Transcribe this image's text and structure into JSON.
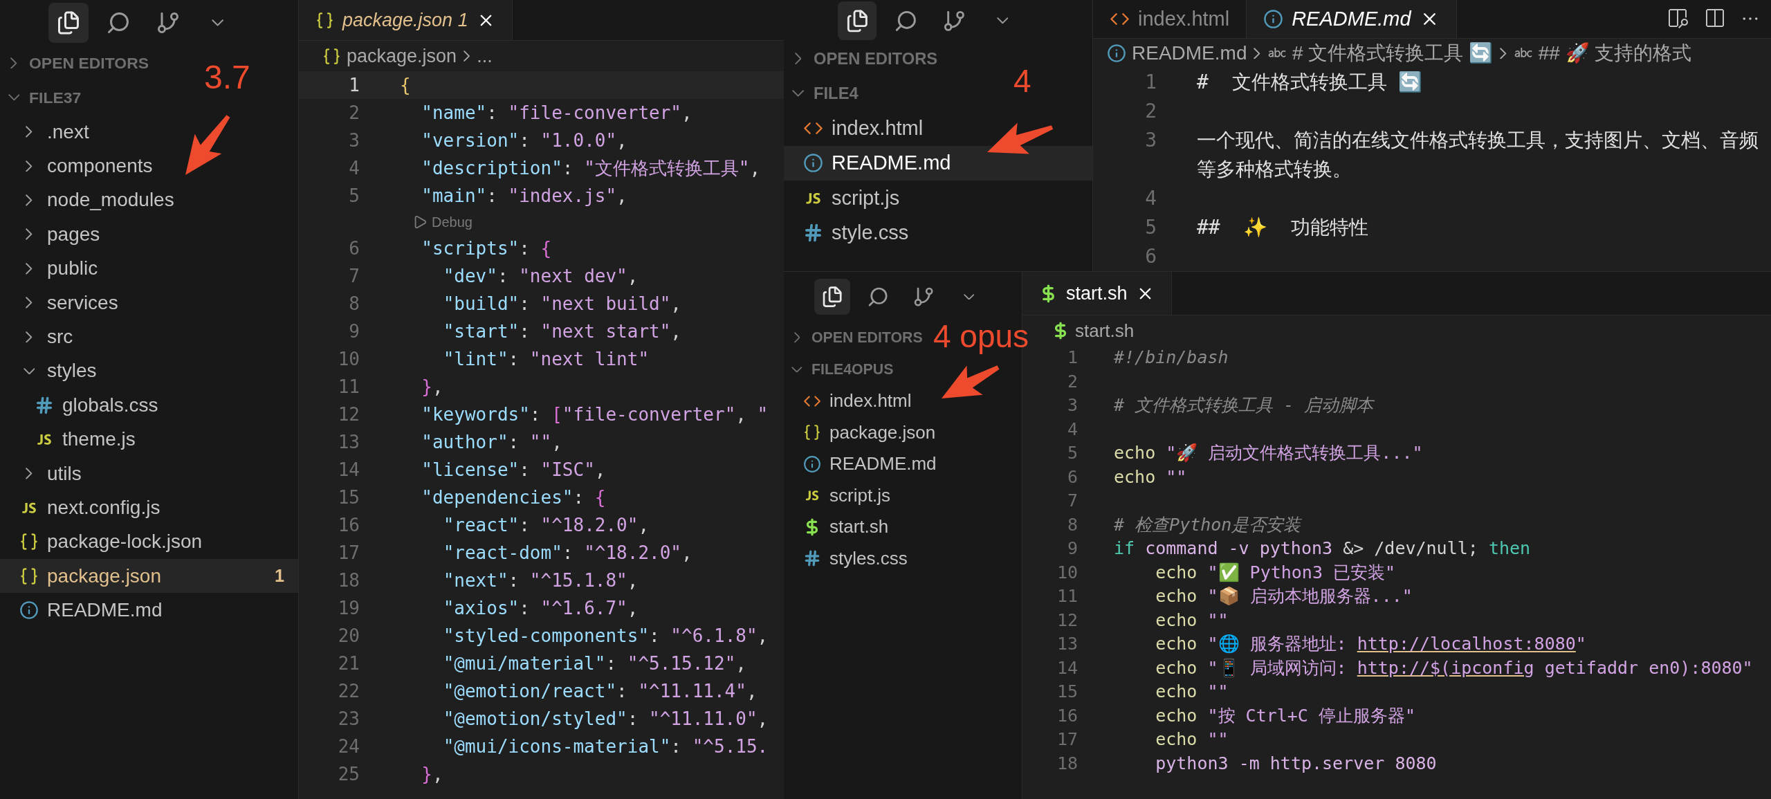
{
  "explorer_file37": {
    "annotation": "3.7",
    "sections": [
      {
        "label": "OPEN EDITORS",
        "expanded": false
      },
      {
        "label": "FILE37",
        "expanded": true
      }
    ],
    "items": [
      {
        "name": ".next",
        "kind": "folder",
        "expanded": false,
        "selected": false
      },
      {
        "name": "components",
        "kind": "folder",
        "expanded": false,
        "selected": false
      },
      {
        "name": "node_modules",
        "kind": "folder",
        "expanded": false,
        "selected": false
      },
      {
        "name": "pages",
        "kind": "folder",
        "expanded": false,
        "selected": false
      },
      {
        "name": "public",
        "kind": "folder",
        "expanded": false,
        "selected": false
      },
      {
        "name": "services",
        "kind": "folder",
        "expanded": false,
        "selected": false
      },
      {
        "name": "src",
        "kind": "folder",
        "expanded": false,
        "selected": false
      },
      {
        "name": "styles",
        "kind": "folder",
        "expanded": true,
        "selected": false,
        "children": [
          {
            "name": "globals.css",
            "kind": "css",
            "selected": false
          },
          {
            "name": "theme.js",
            "kind": "js",
            "selected": false
          }
        ]
      },
      {
        "name": "utils",
        "kind": "folder",
        "expanded": false,
        "selected": false
      },
      {
        "name": "next.config.js",
        "kind": "js",
        "selected": false
      },
      {
        "name": "package-lock.json",
        "kind": "json",
        "selected": false
      },
      {
        "name": "package.json",
        "kind": "json",
        "selected": true,
        "problems": "1"
      },
      {
        "name": "README.md",
        "kind": "md",
        "selected": false
      }
    ]
  },
  "editor_package_json": {
    "tabs": [
      {
        "label": "package.json",
        "kind": "json",
        "preview": true,
        "problems": "1",
        "selected": true
      }
    ],
    "breadcrumb": [
      {
        "text": "package.json",
        "kind": "json"
      },
      {
        "text": "...",
        "kind": "none"
      }
    ],
    "lines": [
      {
        "kind": "code",
        "number": "1",
        "current": true,
        "tokens": [
          {
            "kind": "brace",
            "text": "{"
          }
        ]
      },
      {
        "kind": "code",
        "number": "2",
        "current": false,
        "tokens": [
          {
            "kind": "key",
            "text": "  \"name\""
          },
          {
            "kind": "pun",
            "text": ": "
          },
          {
            "kind": "str",
            "text": "\"file-converter\""
          },
          {
            "kind": "pun",
            "text": ","
          }
        ]
      },
      {
        "kind": "code",
        "number": "3",
        "current": false,
        "tokens": [
          {
            "kind": "key",
            "text": "  \"version\""
          },
          {
            "kind": "pun",
            "text": ": "
          },
          {
            "kind": "str",
            "text": "\"1.0.0\""
          },
          {
            "kind": "pun",
            "text": ","
          }
        ]
      },
      {
        "kind": "code",
        "number": "4",
        "current": false,
        "tokens": [
          {
            "kind": "key",
            "text": "  \"description\""
          },
          {
            "kind": "pun",
            "text": ": "
          },
          {
            "kind": "str",
            "text": "\"文件格式转换工具\""
          },
          {
            "kind": "pun",
            "text": ","
          }
        ]
      },
      {
        "kind": "code",
        "number": "5",
        "current": false,
        "tokens": [
          {
            "kind": "key",
            "text": "  \"main\""
          },
          {
            "kind": "pun",
            "text": ": "
          },
          {
            "kind": "str",
            "text": "\"index.js\""
          },
          {
            "kind": "pun",
            "text": ","
          }
        ]
      },
      {
        "kind": "lens",
        "text": "Debug"
      },
      {
        "kind": "code",
        "number": "6",
        "current": false,
        "tokens": [
          {
            "kind": "key",
            "text": "  \"scripts\""
          },
          {
            "kind": "pun",
            "text": ": "
          },
          {
            "kind": "brace2",
            "text": "{"
          }
        ]
      },
      {
        "kind": "code",
        "number": "7",
        "current": false,
        "tokens": [
          {
            "kind": "key",
            "text": "    \"dev\""
          },
          {
            "kind": "pun",
            "text": ": "
          },
          {
            "kind": "str",
            "text": "\"next dev\""
          },
          {
            "kind": "pun",
            "text": ","
          }
        ]
      },
      {
        "kind": "code",
        "number": "8",
        "current": false,
        "tokens": [
          {
            "kind": "key",
            "text": "    \"build\""
          },
          {
            "kind": "pun",
            "text": ": "
          },
          {
            "kind": "str",
            "text": "\"next build\""
          },
          {
            "kind": "pun",
            "text": ","
          }
        ]
      },
      {
        "kind": "code",
        "number": "9",
        "current": false,
        "tokens": [
          {
            "kind": "key",
            "text": "    \"start\""
          },
          {
            "kind": "pun",
            "text": ": "
          },
          {
            "kind": "str",
            "text": "\"next start\""
          },
          {
            "kind": "pun",
            "text": ","
          }
        ]
      },
      {
        "kind": "code",
        "number": "10",
        "current": false,
        "tokens": [
          {
            "kind": "key",
            "text": "    \"lint\""
          },
          {
            "kind": "pun",
            "text": ": "
          },
          {
            "kind": "str",
            "text": "\"next lint\""
          }
        ]
      },
      {
        "kind": "code",
        "number": "11",
        "current": false,
        "tokens": [
          {
            "kind": "brace2",
            "text": "  }"
          },
          {
            "kind": "pun",
            "text": ","
          }
        ]
      },
      {
        "kind": "code",
        "number": "12",
        "current": false,
        "tokens": [
          {
            "kind": "key",
            "text": "  \"keywords\""
          },
          {
            "kind": "pun",
            "text": ": "
          },
          {
            "kind": "brace2",
            "text": "["
          },
          {
            "kind": "str",
            "text": "\"file-converter\""
          },
          {
            "kind": "pun",
            "text": ", "
          },
          {
            "kind": "str",
            "text": "\""
          }
        ]
      },
      {
        "kind": "code",
        "number": "13",
        "current": false,
        "tokens": [
          {
            "kind": "key",
            "text": "  \"author\""
          },
          {
            "kind": "pun",
            "text": ": "
          },
          {
            "kind": "str",
            "text": "\"\""
          },
          {
            "kind": "pun",
            "text": ","
          }
        ]
      },
      {
        "kind": "code",
        "number": "14",
        "current": false,
        "tokens": [
          {
            "kind": "key",
            "text": "  \"license\""
          },
          {
            "kind": "pun",
            "text": ": "
          },
          {
            "kind": "str",
            "text": "\"ISC\""
          },
          {
            "kind": "pun",
            "text": ","
          }
        ]
      },
      {
        "kind": "code",
        "number": "15",
        "current": false,
        "tokens": [
          {
            "kind": "key",
            "text": "  \"dependencies\""
          },
          {
            "kind": "pun",
            "text": ": "
          },
          {
            "kind": "brace2",
            "text": "{"
          }
        ]
      },
      {
        "kind": "code",
        "number": "16",
        "current": false,
        "tokens": [
          {
            "kind": "key",
            "text": "    \"react\""
          },
          {
            "kind": "pun",
            "text": ": "
          },
          {
            "kind": "str",
            "text": "\"^18.2.0\""
          },
          {
            "kind": "pun",
            "text": ","
          }
        ]
      },
      {
        "kind": "code",
        "number": "17",
        "current": false,
        "tokens": [
          {
            "kind": "key",
            "text": "    \"react-dom\""
          },
          {
            "kind": "pun",
            "text": ": "
          },
          {
            "kind": "str",
            "text": "\"^18.2.0\""
          },
          {
            "kind": "pun",
            "text": ","
          }
        ]
      },
      {
        "kind": "code",
        "number": "18",
        "current": false,
        "tokens": [
          {
            "kind": "key",
            "text": "    \"next\""
          },
          {
            "kind": "pun",
            "text": ": "
          },
          {
            "kind": "str",
            "text": "\"^15.1.8\""
          },
          {
            "kind": "pun",
            "text": ","
          }
        ]
      },
      {
        "kind": "code",
        "number": "19",
        "current": false,
        "tokens": [
          {
            "kind": "key",
            "text": "    \"axios\""
          },
          {
            "kind": "pun",
            "text": ": "
          },
          {
            "kind": "str",
            "text": "\"^1.6.7\""
          },
          {
            "kind": "pun",
            "text": ","
          }
        ]
      },
      {
        "kind": "code",
        "number": "20",
        "current": false,
        "tokens": [
          {
            "kind": "key",
            "text": "    \"styled-components\""
          },
          {
            "kind": "pun",
            "text": ": "
          },
          {
            "kind": "str",
            "text": "\"^6.1.8\""
          },
          {
            "kind": "pun",
            "text": ","
          }
        ]
      },
      {
        "kind": "code",
        "number": "21",
        "current": false,
        "tokens": [
          {
            "kind": "key",
            "text": "    \"@mui/material\""
          },
          {
            "kind": "pun",
            "text": ": "
          },
          {
            "kind": "str",
            "text": "\"^5.15.12\""
          },
          {
            "kind": "pun",
            "text": ","
          }
        ]
      },
      {
        "kind": "code",
        "number": "22",
        "current": false,
        "tokens": [
          {
            "kind": "key",
            "text": "    \"@emotion/react\""
          },
          {
            "kind": "pun",
            "text": ": "
          },
          {
            "kind": "str",
            "text": "\"^11.11.4\""
          },
          {
            "kind": "pun",
            "text": ","
          }
        ]
      },
      {
        "kind": "code",
        "number": "23",
        "current": false,
        "tokens": [
          {
            "kind": "key",
            "text": "    \"@emotion/styled\""
          },
          {
            "kind": "pun",
            "text": ": "
          },
          {
            "kind": "str",
            "text": "\"^11.11.0\""
          },
          {
            "kind": "pun",
            "text": ","
          }
        ]
      },
      {
        "kind": "code",
        "number": "24",
        "current": false,
        "tokens": [
          {
            "kind": "key",
            "text": "    \"@mui/icons-material\""
          },
          {
            "kind": "pun",
            "text": ": "
          },
          {
            "kind": "str",
            "text": "\"^5.15."
          }
        ]
      },
      {
        "kind": "code",
        "number": "25",
        "current": false,
        "tokens": [
          {
            "kind": "brace2",
            "text": "  }"
          },
          {
            "kind": "pun",
            "text": ","
          }
        ]
      }
    ]
  },
  "explorer_file4": {
    "annotation": "4",
    "sections": [
      {
        "label": "OPEN EDITORS",
        "expanded": false
      },
      {
        "label": "FILE4",
        "expanded": true
      }
    ],
    "items": [
      {
        "name": "index.html",
        "kind": "html",
        "selected": false
      },
      {
        "name": "README.md",
        "kind": "md",
        "selected": true
      },
      {
        "name": "script.js",
        "kind": "js",
        "selected": false
      },
      {
        "name": "style.css",
        "kind": "css",
        "selected": false
      }
    ]
  },
  "editor_readme": {
    "tabs": [
      {
        "label": "index.html",
        "kind": "html",
        "preview": false,
        "selected": false
      },
      {
        "label": "README.md",
        "kind": "md",
        "preview": true,
        "selected": true
      }
    ],
    "breadcrumb": [
      {
        "text": "README.md",
        "kind": "md"
      },
      {
        "text": "# 文件格式转换工具 🔄",
        "kind": "heading"
      },
      {
        "text": "## 🚀 支持的格式",
        "kind": "heading"
      }
    ],
    "lines": [
      {
        "kind": "code",
        "number": "1",
        "tokens": [
          {
            "kind": "txt",
            "text": "#  文件格式转换工具 🔄"
          }
        ]
      },
      {
        "kind": "code",
        "number": "2"
      },
      {
        "kind": "code",
        "number": "3",
        "tokens": [
          {
            "kind": "txt",
            "text": "一个现代、简洁的在线文件格式转换工具，支持图片、文档、音频等多种格式转换。"
          }
        ]
      },
      {
        "kind": "code",
        "number": "4"
      },
      {
        "kind": "code",
        "number": "5",
        "tokens": [
          {
            "kind": "txt",
            "text": "##  ✨  功能特性"
          }
        ]
      },
      {
        "kind": "code",
        "number": "6"
      }
    ]
  },
  "explorer_file4opus": {
    "annotation": "4 opus",
    "sections": [
      {
        "label": "OPEN EDITORS",
        "expanded": false
      },
      {
        "label": "FILE4OPUS",
        "expanded": true
      }
    ],
    "items": [
      {
        "name": "index.html",
        "kind": "html",
        "selected": false
      },
      {
        "name": "package.json",
        "kind": "json",
        "selected": false
      },
      {
        "name": "README.md",
        "kind": "md",
        "selected": false
      },
      {
        "name": "script.js",
        "kind": "js",
        "selected": false
      },
      {
        "name": "start.sh",
        "kind": "sh",
        "selected": false
      },
      {
        "name": "styles.css",
        "kind": "css",
        "selected": false
      }
    ]
  },
  "editor_start_sh": {
    "tabs": [
      {
        "label": "start.sh",
        "kind": "sh",
        "preview": false,
        "selected": true
      }
    ],
    "breadcrumb": [
      {
        "text": "start.sh",
        "kind": "sh"
      }
    ],
    "lines": [
      {
        "kind": "code",
        "number": "1",
        "tokens": [
          {
            "kind": "cmt",
            "text": "#!/bin/bash"
          }
        ]
      },
      {
        "kind": "code",
        "number": "2"
      },
      {
        "kind": "code",
        "number": "3",
        "tokens": [
          {
            "kind": "cmt",
            "text": "# 文件格式转换工具 - 启动脚本"
          }
        ]
      },
      {
        "kind": "code",
        "number": "4"
      },
      {
        "kind": "code",
        "number": "5",
        "tokens": [
          {
            "kind": "fn",
            "text": "echo "
          },
          {
            "kind": "str",
            "text": "\"🚀 启动文件格式转换工具...\""
          }
        ]
      },
      {
        "kind": "code",
        "number": "6",
        "tokens": [
          {
            "kind": "fn",
            "text": "echo "
          },
          {
            "kind": "str",
            "text": "\"\""
          }
        ]
      },
      {
        "kind": "code",
        "number": "7"
      },
      {
        "kind": "code",
        "number": "8",
        "tokens": [
          {
            "kind": "cmt",
            "text": "# 检查Python是否安装"
          }
        ]
      },
      {
        "kind": "code",
        "number": "9",
        "tokens": [
          {
            "kind": "kw",
            "text": "if "
          },
          {
            "kind": "cmd",
            "text": "command -v python3"
          },
          {
            "kind": "pun",
            "text": " &> /dev/null; "
          },
          {
            "kind": "kw",
            "text": "then"
          }
        ]
      },
      {
        "kind": "code",
        "number": "10",
        "tokens": [
          {
            "kind": "fn",
            "text": "    echo "
          },
          {
            "kind": "str",
            "text": "\"✅ Python3 已安装\""
          }
        ]
      },
      {
        "kind": "code",
        "number": "11",
        "tokens": [
          {
            "kind": "fn",
            "text": "    echo "
          },
          {
            "kind": "str",
            "text": "\"📦 启动本地服务器...\""
          }
        ]
      },
      {
        "kind": "code",
        "number": "12",
        "tokens": [
          {
            "kind": "fn",
            "text": "    echo "
          },
          {
            "kind": "str",
            "text": "\"\""
          }
        ]
      },
      {
        "kind": "code",
        "number": "13",
        "tokens": [
          {
            "kind": "fn",
            "text": "    echo "
          },
          {
            "kind": "str",
            "text": "\"🌐 服务器地址: "
          },
          {
            "kind": "link",
            "text": "http://localhost:8080"
          },
          {
            "kind": "str",
            "text": "\""
          }
        ]
      },
      {
        "kind": "code",
        "number": "14",
        "tokens": [
          {
            "kind": "fn",
            "text": "    echo "
          },
          {
            "kind": "str",
            "text": "\"📱 局域网访问: "
          },
          {
            "kind": "link",
            "text": "http://$(ipconfig"
          },
          {
            "kind": "str",
            "text": " getifaddr en0):8080\""
          }
        ]
      },
      {
        "kind": "code",
        "number": "15",
        "tokens": [
          {
            "kind": "fn",
            "text": "    echo "
          },
          {
            "kind": "str",
            "text": "\"\""
          }
        ]
      },
      {
        "kind": "code",
        "number": "16",
        "tokens": [
          {
            "kind": "fn",
            "text": "    echo "
          },
          {
            "kind": "str",
            "text": "\"按 Ctrl+C 停止服务器\""
          }
        ]
      },
      {
        "kind": "code",
        "number": "17",
        "tokens": [
          {
            "kind": "fn",
            "text": "    echo "
          },
          {
            "kind": "str",
            "text": "\"\""
          }
        ]
      },
      {
        "kind": "code",
        "number": "18",
        "tokens": [
          {
            "kind": "cmd",
            "text": "    python3 -m http.server 8080"
          }
        ]
      }
    ]
  }
}
